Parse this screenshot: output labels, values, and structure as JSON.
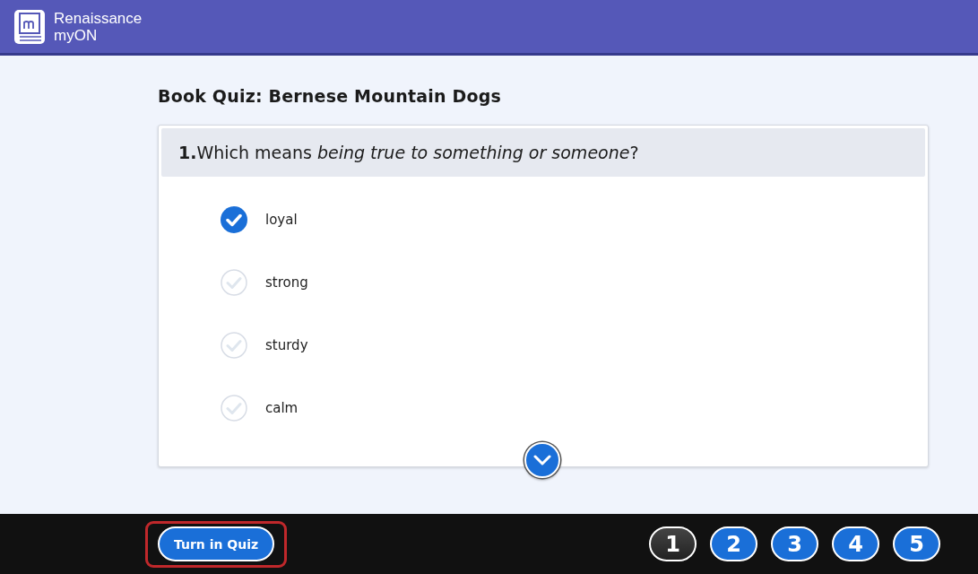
{
  "header": {
    "brand_line_1": "Renaissance",
    "brand_line_2": "myON"
  },
  "quiz": {
    "title": "Book Quiz: Bernese Mountain Dogs",
    "question_number": "1.",
    "question": "Which means *being true to something or someone*?",
    "options": [
      {
        "label": "loyal",
        "selected": true
      },
      {
        "label": "strong",
        "selected": false
      },
      {
        "label": "sturdy",
        "selected": false
      },
      {
        "label": "calm",
        "selected": false
      }
    ]
  },
  "footer": {
    "turn_in_button": {
      "label": "Turn in Quiz",
      "highlighted": true
    },
    "question_pages": [
      {
        "label": "1",
        "selected": true
      },
      {
        "label": "2",
        "selected": false
      },
      {
        "label": "3",
        "selected": false
      },
      {
        "label": "4",
        "selected": false
      },
      {
        "label": "5",
        "selected": false
      }
    ]
  }
}
